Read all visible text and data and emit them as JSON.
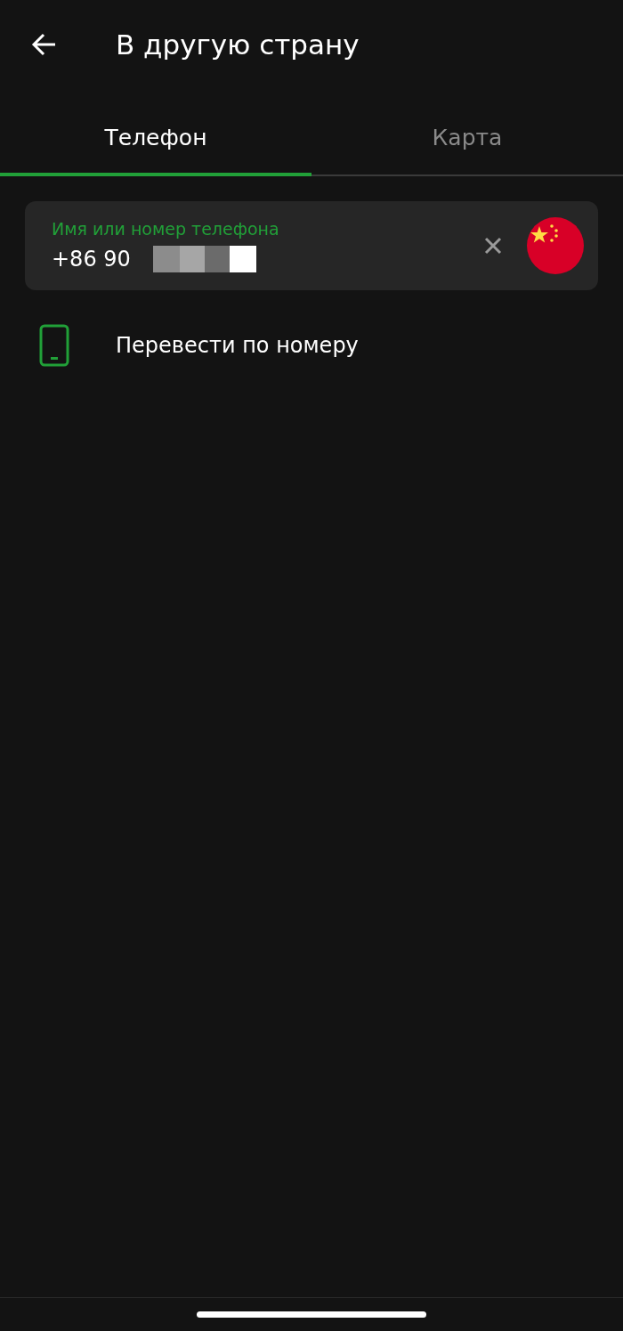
{
  "header": {
    "title": "В другую страну"
  },
  "tabs": [
    {
      "label": "Телефон",
      "selected": true
    },
    {
      "label": "Карта",
      "selected": false
    }
  ],
  "recipient_field": {
    "label": "Имя или номер телефона",
    "value": "+86 90"
  },
  "actions": [
    {
      "label": "Перевести по номеру"
    }
  ]
}
